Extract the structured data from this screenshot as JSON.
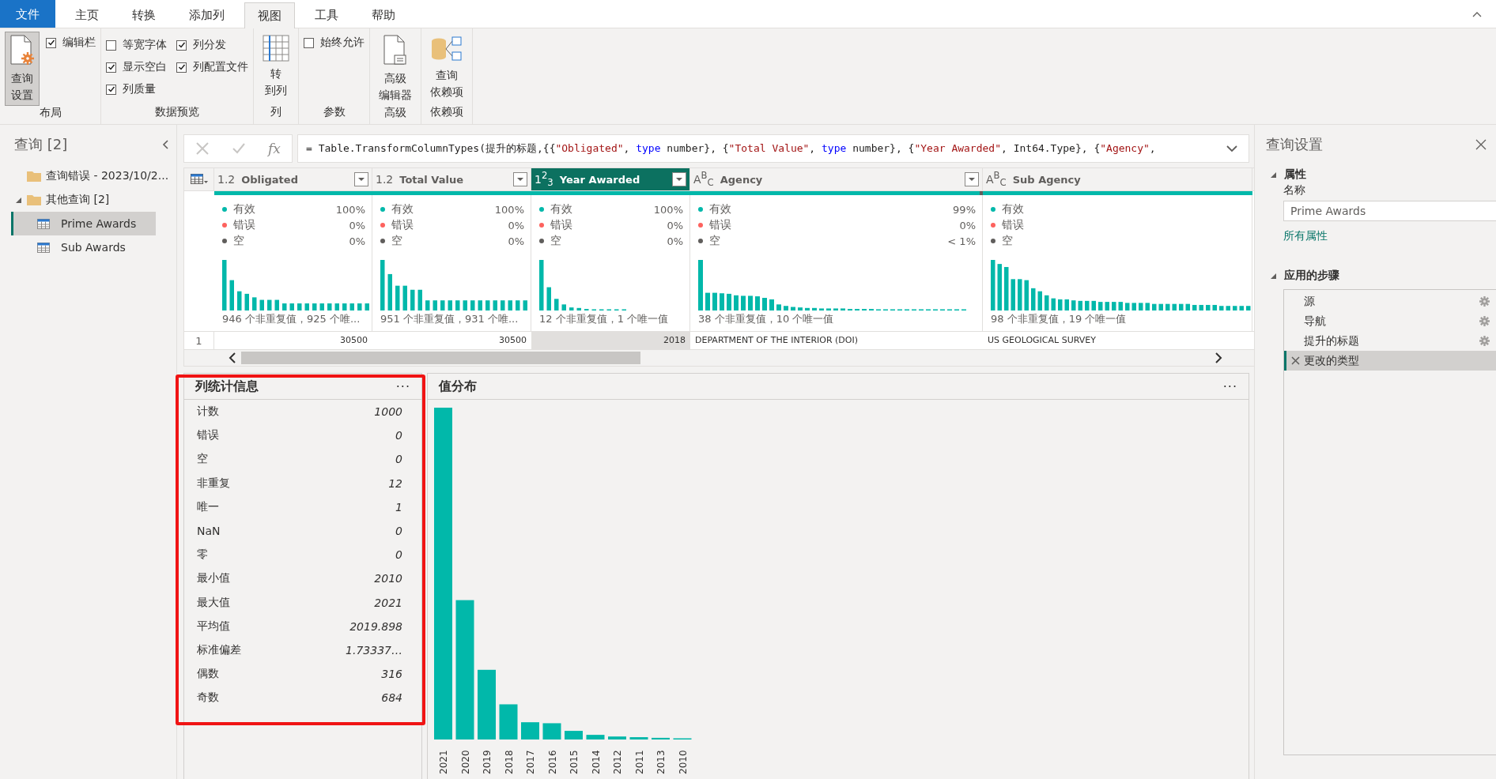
{
  "ribbon": {
    "tabs": [
      {
        "label": "文件",
        "kind": "file",
        "selected": false
      },
      {
        "label": "主页",
        "kind": "tab",
        "selected": false
      },
      {
        "label": "转换",
        "kind": "tab",
        "selected": false
      },
      {
        "label": "添加列",
        "kind": "tab",
        "selected": false
      },
      {
        "label": "视图",
        "kind": "tab",
        "selected": true
      },
      {
        "label": "工具",
        "kind": "tab",
        "selected": false
      },
      {
        "label": "帮助",
        "kind": "tab",
        "selected": false
      }
    ],
    "groups": [
      {
        "label": "布局",
        "items": [
          {
            "kind": "big-button",
            "lines": [
              "查询",
              "设置"
            ],
            "pressed": true
          },
          {
            "kind": "checkbox",
            "label": "编辑栏",
            "checked": true
          }
        ]
      },
      {
        "label": "数据预览",
        "items": [
          {
            "kind": "checkbox",
            "label": "等宽字体",
            "checked": false
          },
          {
            "kind": "checkbox",
            "label": "列分发",
            "checked": true
          },
          {
            "kind": "checkbox",
            "label": "显示空白",
            "checked": true
          },
          {
            "kind": "checkbox",
            "label": "列配置文件",
            "checked": true
          },
          {
            "kind": "checkbox",
            "label": "列质量",
            "checked": true
          }
        ]
      },
      {
        "label": "列",
        "items": [
          {
            "kind": "big-button",
            "lines": [
              "转",
              "到列"
            ],
            "pressed": false
          }
        ]
      },
      {
        "label": "参数",
        "items": [
          {
            "kind": "checkbox",
            "label": "始终允许",
            "checked": false
          }
        ]
      },
      {
        "label": "高级",
        "items": [
          {
            "kind": "big-button",
            "lines": [
              "高级",
              "编辑器"
            ],
            "pressed": false
          }
        ]
      },
      {
        "label": "依赖项",
        "items": [
          {
            "kind": "big-button",
            "lines": [
              "查询",
              "依赖项"
            ],
            "pressed": false
          }
        ]
      }
    ]
  },
  "queries": {
    "title": "查询 [2]",
    "items": [
      {
        "kind": "folder",
        "label": "查询错误 - 2023/10/2..."
      },
      {
        "kind": "folder",
        "label": "其他查询 [2]",
        "expanded": true,
        "children": [
          {
            "kind": "table",
            "label": "Prime Awards",
            "selected": true
          },
          {
            "kind": "table",
            "label": "Sub Awards",
            "selected": false
          }
        ]
      }
    ]
  },
  "formula_bar": {
    "fx": "fx",
    "tokens": [
      {
        "text": "= Table.TransformColumnTypes(提升的标题,{{",
        "kind": "plain"
      },
      {
        "text": "\"Obligated\"",
        "kind": "string"
      },
      {
        "text": ", ",
        "kind": "plain"
      },
      {
        "text": "type",
        "kind": "keyword"
      },
      {
        "text": " number}, {",
        "kind": "plain"
      },
      {
        "text": "\"Total Value\"",
        "kind": "string"
      },
      {
        "text": ", ",
        "kind": "plain"
      },
      {
        "text": "type",
        "kind": "keyword"
      },
      {
        "text": " number}, {",
        "kind": "plain"
      },
      {
        "text": "\"Year Awarded\"",
        "kind": "string"
      },
      {
        "text": ", Int64.Type}, {",
        "kind": "plain"
      },
      {
        "text": "\"Agency\"",
        "kind": "string"
      },
      {
        "text": ",",
        "kind": "plain"
      }
    ]
  },
  "table": {
    "row_number": "1",
    "columns": [
      {
        "type": "1.2",
        "name": "Obligated",
        "selected": false,
        "dropdown": true,
        "level": 1,
        "quality": [
          {
            "label": "有效",
            "value": "100%",
            "color": "#01b8aa"
          },
          {
            "label": "错误",
            "value": "0%",
            "color": "#fd625e"
          },
          {
            "label": "空",
            "value": "0%",
            "color": "#605e5c"
          }
        ],
        "summary": "946 个非重复值，925 个唯...",
        "row_1": "30500"
      },
      {
        "type": "1.2",
        "name": "Total Value",
        "selected": false,
        "dropdown": true,
        "level": 1,
        "quality": [
          {
            "label": "有效",
            "value": "100%",
            "color": "#01b8aa"
          },
          {
            "label": "错误",
            "value": "0%",
            "color": "#fd625e"
          },
          {
            "label": "空",
            "value": "0%",
            "color": "#605e5c"
          }
        ],
        "summary": "951 个非重复值，931 个唯...",
        "row_1": "30500"
      },
      {
        "type": "1$^{2}$$_{3}$",
        "name": "Year Awarded",
        "selected": true,
        "dropdown": true,
        "level": 1,
        "quality": [
          {
            "label": "有效",
            "value": "100%",
            "color": "#01b8aa"
          },
          {
            "label": "错误",
            "value": "0%",
            "color": "#fd625e"
          },
          {
            "label": "空",
            "value": "0%",
            "color": "#605e5c"
          }
        ],
        "summary": "12 个非重复值，1 个唯一值",
        "row_1": "2018"
      },
      {
        "type": "A$^{B}$$_{C}$",
        "name": "Agency",
        "selected": false,
        "dropdown": true,
        "level": 0.99,
        "quality": [
          {
            "label": "有效",
            "value": "99%",
            "color": "#01b8aa"
          },
          {
            "label": "错误",
            "value": "0%",
            "color": "#fd625e"
          },
          {
            "label": "空",
            "value": "< 1%",
            "color": "#605e5c"
          }
        ],
        "summary": "38 个非重复值，10 个唯一值",
        "row_1": "DEPARTMENT OF THE INTERIOR (DOI)"
      },
      {
        "type": "A$^{B}$$_{C}$",
        "name": "Sub Agency",
        "selected": false,
        "dropdown": false,
        "level": 1,
        "quality": [
          {
            "label": "有效",
            "color": "#01b8aa"
          },
          {
            "label": "错误",
            "color": "#fd625e"
          },
          {
            "label": "空",
            "color": "#605e5c"
          }
        ],
        "summary": "98 个非重复值，19 个唯一值",
        "row_1": "US GEOLOGICAL SURVEY"
      }
    ]
  },
  "column_statistics": {
    "title": "列统计信息",
    "menu": "···",
    "rows": [
      {
        "label": "计数",
        "value": "1000"
      },
      {
        "label": "错误",
        "value": "0"
      },
      {
        "label": "空",
        "value": "0"
      },
      {
        "label": "非重复",
        "value": "12"
      },
      {
        "label": "唯一",
        "value": "1"
      },
      {
        "label": "NaN",
        "value": "0"
      },
      {
        "label": "零",
        "value": "0"
      },
      {
        "label": "最小值",
        "value": "2010"
      },
      {
        "label": "最大值",
        "value": "2021"
      },
      {
        "label": "平均值",
        "value": "2019.898"
      },
      {
        "label": "标准偏差",
        "value": "1.73337…"
      },
      {
        "label": "偶数",
        "value": "316"
      },
      {
        "label": "奇数",
        "value": "684"
      }
    ]
  },
  "value_distribution": {
    "title": "值分布",
    "menu": "···",
    "categories": [
      "2021",
      "2020",
      "2019",
      "2018",
      "2017",
      "2016",
      "2015",
      "2014",
      "2012",
      "2011",
      "2013",
      "2010"
    ]
  },
  "query_settings": {
    "title": "查询设置",
    "properties": {
      "title": "属性",
      "expanded": true,
      "name_label": "名称",
      "name_value": "Prime Awards",
      "link": "所有属性"
    },
    "steps": {
      "title": "应用的步骤",
      "expanded": true,
      "items": [
        {
          "label": "源",
          "settings": true,
          "selected": false
        },
        {
          "label": "导航",
          "settings": true,
          "selected": false
        },
        {
          "label": "提升的标题",
          "settings": true,
          "selected": false
        },
        {
          "label": "更改的类型",
          "settings": false,
          "selected": true
        }
      ]
    }
  }
}
